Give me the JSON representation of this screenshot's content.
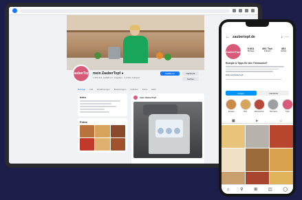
{
  "facebook": {
    "page_name": "mein ZauberTopf ●",
    "page_sub": "1.261.412 „Gefällt mir“-Angaben · 1,4 Mio. Follower",
    "avatar_text": "ZauberTopf",
    "follow_button": "Gefällt mir",
    "message_button": "Nachricht",
    "search_button": "Suchen",
    "tabs": [
      "Beiträge",
      "Info",
      "Erwähnungen",
      "Bewertungen",
      "Follower",
      "Fotos",
      "Mehr"
    ],
    "intro_title": "Intro",
    "photos_title": "Fotos",
    "post_title": "mein ZauberTopf"
  },
  "instagram": {
    "username": "zaubertopf.de",
    "avatar_text": "ZauberTopf",
    "stats": [
      {
        "value": "5.661",
        "label": "Beiträge"
      },
      {
        "value": "491 Tsd.",
        "label": "Follower"
      },
      {
        "value": "351",
        "label": "Gefolgt"
      }
    ],
    "bio_name": "Rezepte & Tipps für den Thermomix®",
    "bio_link": "linktr.ee/zaubertopf",
    "follow_label": "Folgen",
    "message_label": "Nachricht",
    "highlights": [
      "Rezepte",
      "Brot",
      "Weihnachten",
      "Thermomix",
      "Tipps"
    ]
  },
  "colors": {
    "background": "#1c1d48",
    "facebook_blue": "#1877f2",
    "instagram_blue": "#0095f6",
    "brand_pink": "#d95a78"
  }
}
